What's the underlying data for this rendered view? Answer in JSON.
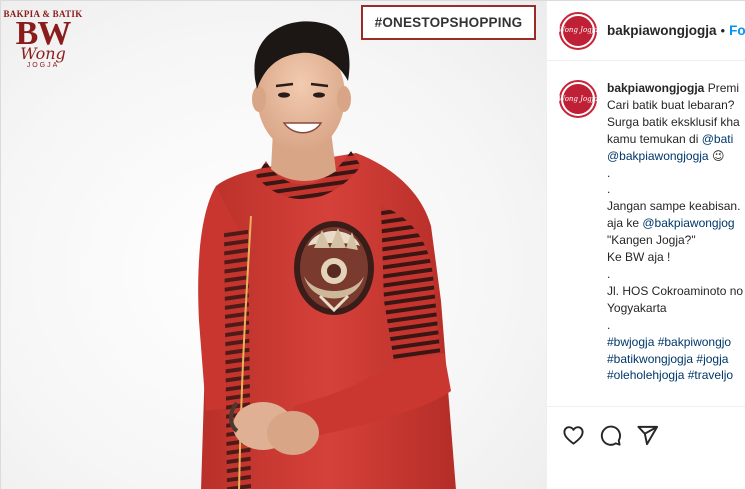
{
  "media": {
    "brand": {
      "top": "BAKPIA & BATIK",
      "big": "BW",
      "script": "Wong",
      "sub": "JOGJA"
    },
    "hashtag": "#ONESTOPSHOPPING"
  },
  "header": {
    "avatar_text": "Wong Jogja",
    "username": "bakpiawongjogja",
    "separator": "•",
    "follow": "Follo"
  },
  "caption": {
    "avatar_text": "Wong Jogja",
    "username": "bakpiawongjogja",
    "first": "Premi",
    "lines": [
      "Cari batik buat lebaran?",
      "Surga batik eksklusif kha",
      "kamu temukan di ",
      "",
      ".",
      ".",
      "Jangan sampe keabisan.",
      "aja ke ",
      "\"Kangen Jogja?\"",
      "Ke BW aja !",
      ".",
      "Jl. HOS Cokroaminoto no",
      "Yogyakarta",
      ".",
      "",
      "",
      ""
    ],
    "mention_bati": "@bati",
    "mention_bakpia": "@bakpiawongjogja",
    "emoji": "😉",
    "mention_wongjog": "@bakpiawongjog",
    "tags_line1": "#bwjogja #bakpiwongjo",
    "tags_line2": "#batikwongjogja #jogja",
    "tags_line3": "#oleholehjogja #traveljo"
  },
  "actions": {
    "like": "heart-icon",
    "comment": "comment-icon",
    "share": "share-icon"
  },
  "colors": {
    "brand_red": "#8b1c1c",
    "shirt_red": "#cf3a32",
    "link": "#00376b",
    "follow_blue": "#0095f6"
  }
}
